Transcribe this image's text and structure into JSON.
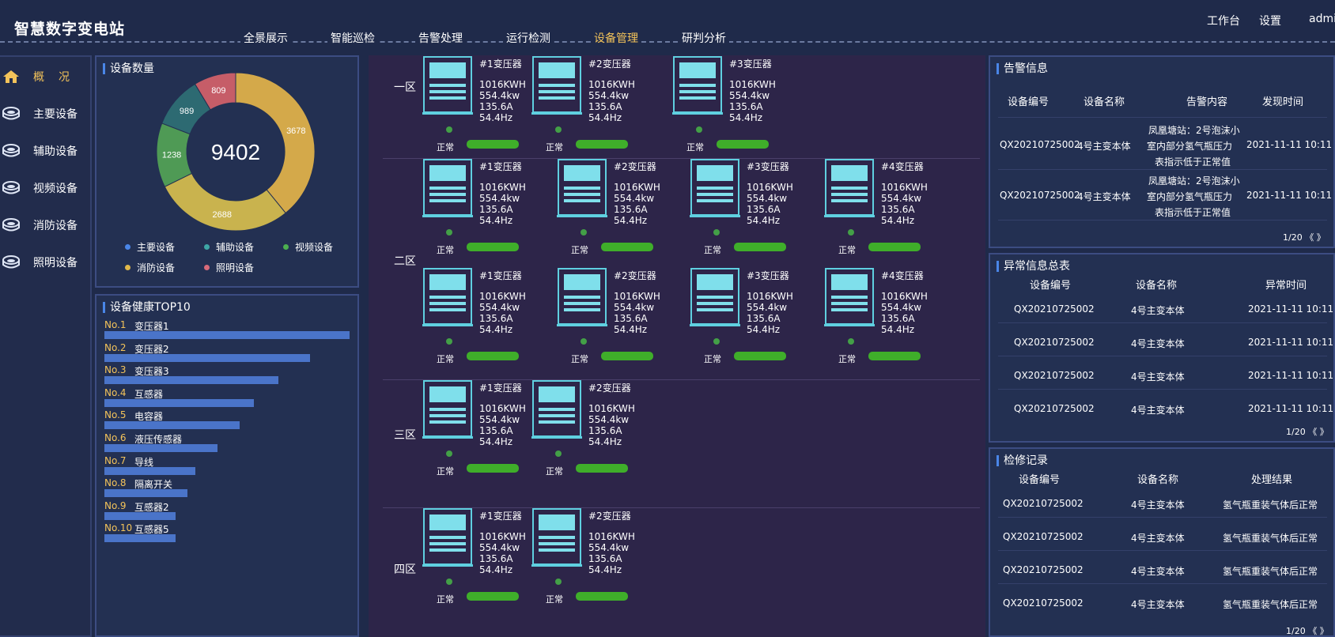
{
  "header": {
    "title": "智慧数字变电站",
    "nav": [
      "全景展示",
      "智能巡检",
      "告警处理",
      "运行检测",
      "设备管理",
      "研判分析"
    ],
    "active_nav": "设备管理",
    "right": {
      "workbench": "工作台",
      "settings": "设置",
      "user": "admi"
    }
  },
  "sidebar": {
    "items": [
      {
        "label": "概况",
        "icon": "home-icon",
        "active": true
      },
      {
        "label": "主要设备",
        "icon": "device-icon"
      },
      {
        "label": "辅助设备",
        "icon": "device-icon"
      },
      {
        "label": "视频设备",
        "icon": "device-icon"
      },
      {
        "label": "消防设备",
        "icon": "device-icon"
      },
      {
        "label": "照明设备",
        "icon": "device-icon"
      }
    ]
  },
  "device_count": {
    "title": "设备数量",
    "total": "9402",
    "chart_data": {
      "type": "pie",
      "slices": [
        {
          "label": "主要设备",
          "value": 3678,
          "color": "#d4a94a"
        },
        {
          "label": "消防设备",
          "value": 2688,
          "color": "#c9b34e"
        },
        {
          "label": "视频设备",
          "value": 1238,
          "color": "#4f9a55"
        },
        {
          "label": "辅助设备",
          "value": 989,
          "color": "#2d6a72"
        },
        {
          "label": "照明设备",
          "value": 809,
          "color": "#c65d68"
        }
      ],
      "legend": [
        {
          "label": "主要设备",
          "color": "#4a86e8"
        },
        {
          "label": "辅助设备",
          "color": "#3ea6a6"
        },
        {
          "label": "视频设备",
          "color": "#4caf50"
        },
        {
          "label": "消防设备",
          "color": "#e0b84a"
        },
        {
          "label": "照明设备",
          "color": "#d86a7a"
        }
      ]
    }
  },
  "health_top10": {
    "title": "设备健康TOP10",
    "chart_data": {
      "type": "bar",
      "categories": [
        "变压器1",
        "变压器2",
        "变压器3",
        "互感器",
        "电容器",
        "液压传感器",
        "导线",
        "隔离开关",
        "互感器2",
        "互感器5"
      ],
      "ranks": [
        "No.1",
        "No.2",
        "No.3",
        "No.4",
        "No.5",
        "No.6",
        "No.7",
        "No.8",
        "No.9",
        "No.10"
      ],
      "values": [
        100,
        84,
        71,
        61,
        55,
        46,
        37,
        34,
        29,
        29
      ]
    }
  },
  "zones": [
    {
      "label": "一区",
      "rows": [
        [
          "#1变压器",
          "#2变压器",
          "#3变压器"
        ]
      ]
    },
    {
      "label": "二区",
      "rows": [
        [
          "#1变压器",
          "#2变压器",
          "#3变压器",
          "#4变压器"
        ],
        [
          "#1变压器",
          "#2变压器",
          "#3变压器",
          "#4变压器"
        ]
      ]
    },
    {
      "label": "三区",
      "rows": [
        [
          "#1变压器",
          "#2变压器"
        ]
      ]
    },
    {
      "label": "四区",
      "rows": [
        [
          "#1变压器",
          "#2变压器"
        ]
      ]
    }
  ],
  "device_specs": [
    "1016KWH",
    "554.4kw",
    "135.6A",
    "54.4Hz"
  ],
  "device_status": "正常",
  "alarm_info": {
    "title": "告警信息",
    "headers": [
      "设备编号",
      "设备名称",
      "告警内容",
      "发现时间"
    ],
    "rows": [
      {
        "id": "QX20210725002",
        "name": "4号主变本体",
        "content": [
          "凤凰塘站：2号泡沫小",
          "室内部分氢气瓶压力",
          "表指示低于正常值"
        ],
        "time": "2021-11-11 10:11"
      },
      {
        "id": "QX20210725002",
        "name": "4号主变本体",
        "content": [
          "凤凰塘站：2号泡沫小",
          "室内部分氢气瓶压力",
          "表指示低于正常值"
        ],
        "time": "2021-11-11 10:11"
      }
    ],
    "pager": "1/20 《 》"
  },
  "abnormal_summary": {
    "title": "异常信息总表",
    "headers": [
      "设备编号",
      "设备名称",
      "异常时间"
    ],
    "rows": [
      [
        "QX20210725002",
        "4号主变本体",
        "2021-11-11 10:11"
      ],
      [
        "QX20210725002",
        "4号主变本体",
        "2021-11-11 10:11"
      ],
      [
        "QX20210725002",
        "4号主变本体",
        "2021-11-11 10:11"
      ],
      [
        "QX20210725002",
        "4号主变本体",
        "2021-11-11 10:11"
      ]
    ],
    "pager": "1/20 《 》"
  },
  "repair_records": {
    "title": "检修记录",
    "headers": [
      "设备编号",
      "设备名称",
      "处理结果"
    ],
    "rows": [
      [
        "QX20210725002",
        "4号主变本体",
        "氢气瓶重装气体后正常"
      ],
      [
        "QX20210725002",
        "4号主变本体",
        "氢气瓶重装气体后正常"
      ],
      [
        "QX20210725002",
        "4号主变本体",
        "氢气瓶重装气体后正常"
      ],
      [
        "QX20210725002",
        "4号主变本体",
        "氢气瓶重装气体后正常"
      ]
    ],
    "pager": "1/20 《 》"
  }
}
